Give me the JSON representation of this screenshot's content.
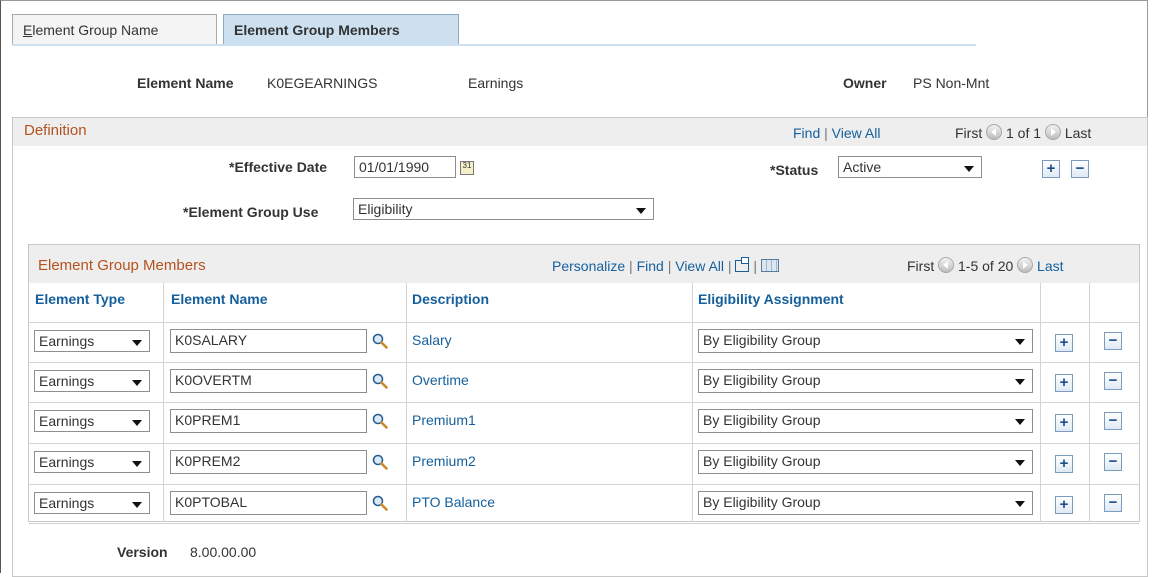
{
  "tabs": [
    {
      "label_prefix": "E",
      "label_rest": "lement Group Name"
    },
    {
      "label": "Element Group Members"
    }
  ],
  "header": {
    "element_name_label": "Element Name",
    "element_name_value": "K0EGEARNINGS",
    "element_desc": "Earnings",
    "owner_label": "Owner",
    "owner_value": "PS Non-Mnt"
  },
  "definition": {
    "title": "Definition",
    "find": "Find",
    "view_all": "View All",
    "first": "First",
    "range": "1 of 1",
    "last": "Last",
    "effective_date_label": "*Effective Date",
    "effective_date_value": "01/01/1990",
    "calendar_glyph": "31",
    "status_label": "*Status",
    "status_value": "Active",
    "group_use_label": "*Element Group Use",
    "group_use_value": "Eligibility"
  },
  "grid": {
    "title": "Element Group Members",
    "personalize": "Personalize",
    "find": "Find",
    "view_all": "View All",
    "first": "First",
    "range": "1-5 of 20",
    "last": "Last",
    "columns": [
      "Element Type",
      "Element Name",
      "Description",
      "Eligibility Assignment"
    ],
    "rows": [
      {
        "type": "Earnings",
        "name": "K0SALARY",
        "description": "Salary",
        "assignment": "By Eligibility Group"
      },
      {
        "type": "Earnings",
        "name": "K0OVERTM",
        "description": "Overtime",
        "assignment": "By Eligibility Group"
      },
      {
        "type": "Earnings",
        "name": "K0PREM1",
        "description": "Premium1",
        "assignment": "By Eligibility Group"
      },
      {
        "type": "Earnings",
        "name": "K0PREM2",
        "description": "Premium2",
        "assignment": "By Eligibility Group"
      },
      {
        "type": "Earnings",
        "name": "K0PTOBAL",
        "description": "PTO Balance",
        "assignment": "By Eligibility Group"
      }
    ]
  },
  "footer": {
    "version_label": "Version",
    "version_value": "8.00.00.00"
  },
  "icons": {
    "add": "+",
    "remove": "−"
  },
  "colors": {
    "link": "#15609c",
    "section_title": "#b4521e",
    "active_tab": "#cde0ef"
  }
}
